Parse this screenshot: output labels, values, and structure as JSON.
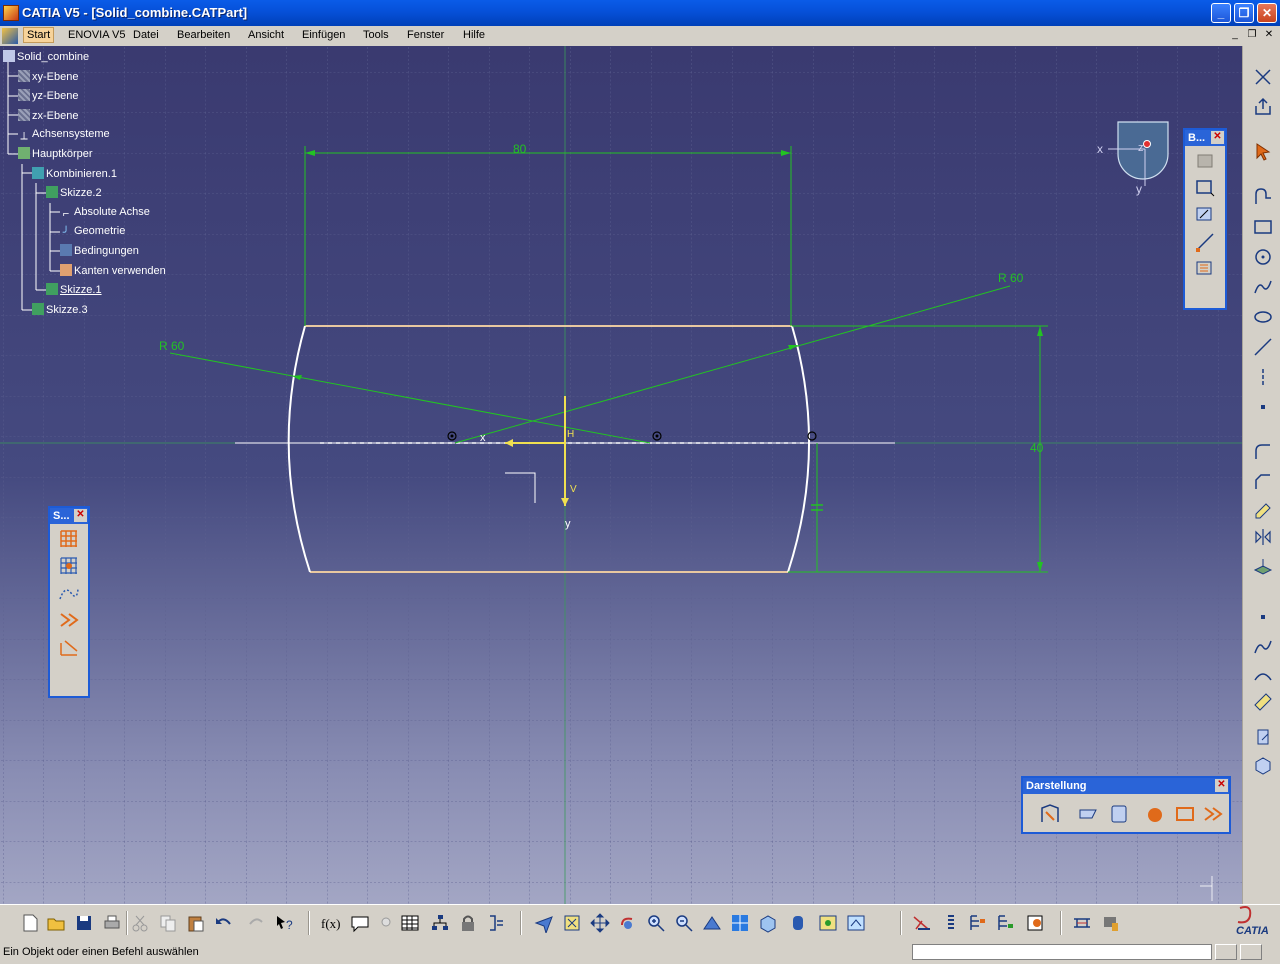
{
  "window": {
    "title": "CATIA V5 - [Solid_combine.CATPart]"
  },
  "menu": {
    "items": [
      "Start",
      "ENOVIA V5",
      "Datei",
      "Bearbeiten",
      "Ansicht",
      "Einfügen",
      "Tools",
      "Fenster",
      "Hilfe"
    ],
    "active": "Start"
  },
  "tree": {
    "root": "Solid_combine",
    "xy_plane": "xy-Ebene",
    "yz_plane": "yz-Ebene",
    "zx_plane": "zx-Ebene",
    "axis_systems": "Achsensysteme",
    "main_body": "Hauptkörper",
    "combine": "Kombinieren.1",
    "sketch2": "Skizze.2",
    "absolute_axis": "Absolute Achse",
    "geometry": "Geometrie",
    "constraints": "Bedingungen",
    "use_edges": "Kanten verwenden",
    "sketch1": "Skizze.1",
    "sketch3": "Skizze.3"
  },
  "sketch": {
    "dim_width": "80",
    "dim_height": "40",
    "radius_right": "R 60",
    "radius_left": "R 60",
    "h_label": "H",
    "v_label": "V",
    "x_label": "x",
    "y_label": "y"
  },
  "compass": {
    "x_label": "x",
    "y_label": "y",
    "z_label": "z"
  },
  "toolbars": {
    "sketch_tools_title": "S...",
    "b_toolbar_title": "B...",
    "darstellung_title": "Darstellung"
  },
  "status": {
    "message": "Ein Objekt oder einen Befehl auswählen",
    "command_value": ""
  },
  "brand": {
    "logo_text": "CATIA"
  },
  "colors": {
    "viewport_top": "#3a3a70",
    "dimension_green": "#22c322",
    "profile_white": "#ffffff",
    "tree_text": "#ffffff",
    "title_blue": "#0650d8"
  }
}
